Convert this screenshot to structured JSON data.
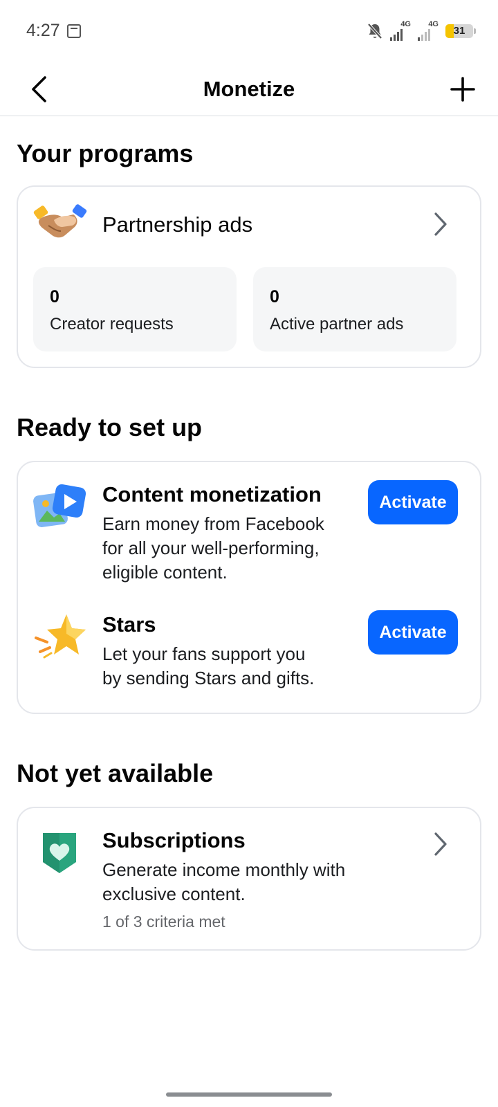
{
  "status_bar": {
    "time": "4:27",
    "network_1": "4G",
    "network_2": "4G",
    "battery": "31",
    "battery_level": 0.31,
    "icons": [
      "screenshot-icon",
      "bell-off-icon",
      "signal-icon",
      "battery-icon"
    ]
  },
  "header": {
    "title": "Monetize",
    "back_icon": "chevron-left-icon",
    "add_icon": "plus-icon"
  },
  "sections": {
    "your_programs": {
      "title": "Your programs",
      "partnership": {
        "title": "Partnership ads",
        "icon": "handshake-icon",
        "stats": [
          {
            "value": "0",
            "label": "Creator requests"
          },
          {
            "value": "0",
            "label": "Active partner ads"
          }
        ]
      }
    },
    "ready": {
      "title": "Ready to set up",
      "items": [
        {
          "title": "Content monetization",
          "desc_lines": [
            "Earn money from Facebook",
            "for all your well-performing,",
            "eligible content."
          ],
          "button": "Activate",
          "icon": "media-play-icon"
        },
        {
          "title": "Stars",
          "desc_lines": [
            "Let your fans support you",
            "by sending Stars and gifts."
          ],
          "button": "Activate",
          "icon": "star-icon"
        }
      ]
    },
    "not_available": {
      "title": "Not yet available",
      "subscriptions": {
        "title": "Subscriptions",
        "desc_lines": [
          "Generate income monthly with",
          "exclusive content."
        ],
        "criteria": "1 of 3 criteria met",
        "icon": "heart-badge-icon"
      }
    }
  },
  "colors": {
    "accent": "#0866ff",
    "card_border": "#e4e6eb",
    "stat_bg": "#f5f6f7",
    "secondary_text": "#65676b"
  }
}
